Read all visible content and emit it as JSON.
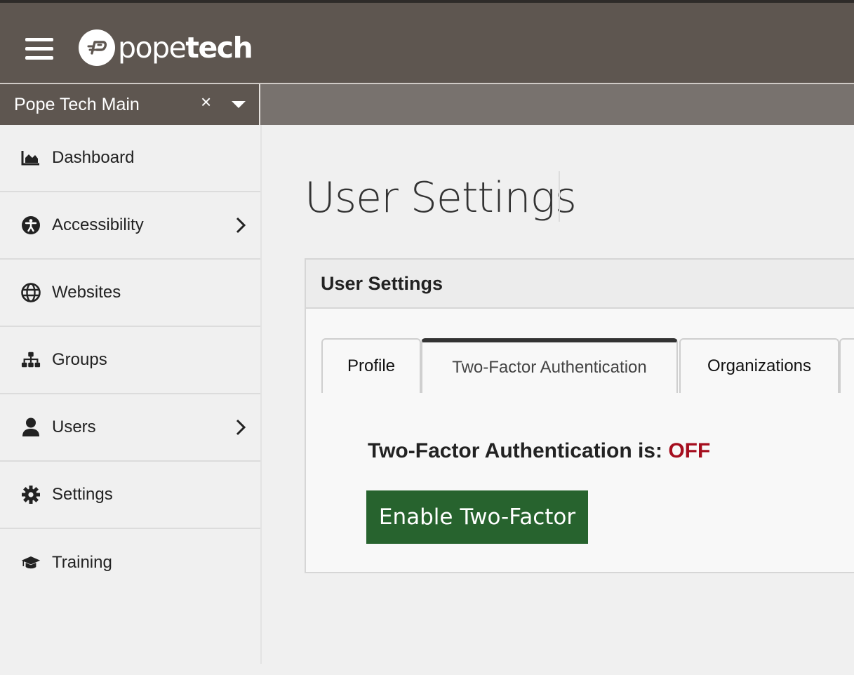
{
  "header": {
    "logo_pope": "pope",
    "logo_tech": "tech",
    "background": "#5e5650"
  },
  "org_select": {
    "value": "Pope Tech Main",
    "clear_symbol": "×"
  },
  "sidebar": {
    "items": [
      {
        "label": "Dashboard",
        "icon": "chart-area-icon",
        "has_submenu": false
      },
      {
        "label": "Accessibility",
        "icon": "universal-access-icon",
        "has_submenu": true
      },
      {
        "label": "Websites",
        "icon": "globe-icon",
        "has_submenu": false
      },
      {
        "label": "Groups",
        "icon": "sitemap-icon",
        "has_submenu": false
      },
      {
        "label": "Users",
        "icon": "user-icon",
        "has_submenu": true
      },
      {
        "label": "Settings",
        "icon": "gear-icon",
        "has_submenu": false
      },
      {
        "label": "Training",
        "icon": "graduation-cap-icon",
        "has_submenu": false
      }
    ]
  },
  "page": {
    "title": "User Settings"
  },
  "card": {
    "title": "User Settings",
    "tabs": [
      {
        "label": "Profile",
        "active": false
      },
      {
        "label": "Two-Factor Authentication",
        "active": true
      },
      {
        "label": "Organizations",
        "active": false
      }
    ],
    "status_prefix": "Two-Factor Authentication is:",
    "status_value": "OFF",
    "status_color": "#a50e1e",
    "enable_button": "Enable Two-Factor",
    "button_color": "#27632e"
  }
}
